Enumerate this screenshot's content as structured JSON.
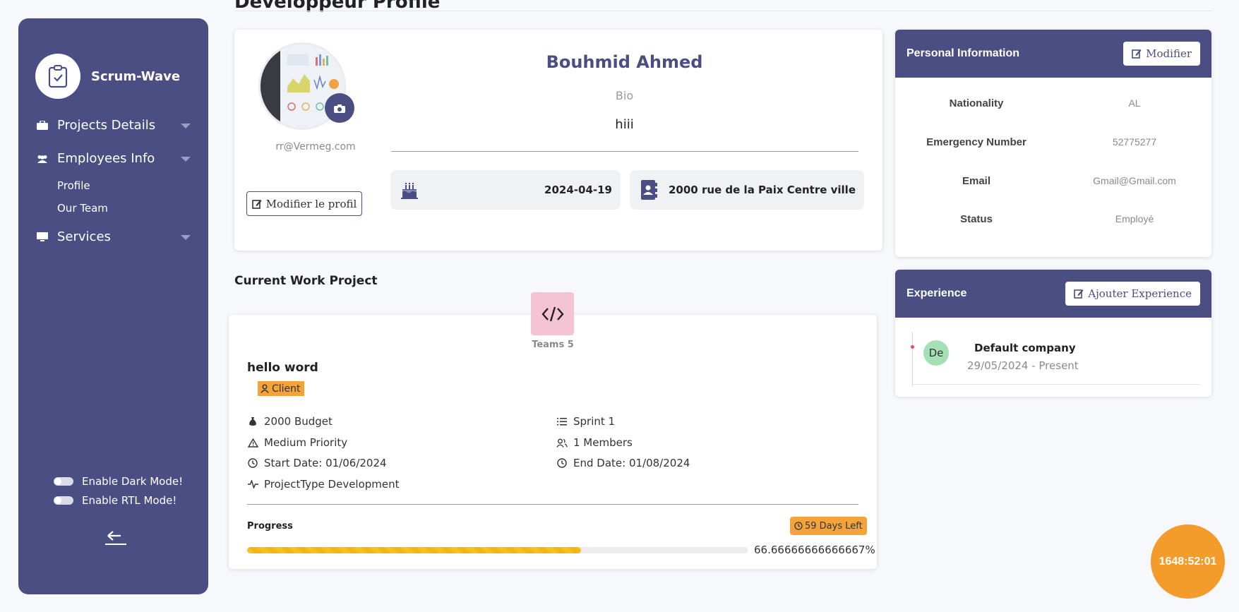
{
  "page": {
    "title": "Développeur Profile"
  },
  "brand": {
    "name": "Scrum-Wave"
  },
  "sidebar": {
    "items": [
      {
        "label": "Projects Details"
      },
      {
        "label": "Employees Info"
      },
      {
        "label": "Services"
      }
    ],
    "subitems": [
      {
        "label": "Profile"
      },
      {
        "label": "Our Team"
      }
    ],
    "toggles": [
      {
        "label": "Enable Dark Mode!"
      },
      {
        "label": "Enable RTL Mode!"
      }
    ]
  },
  "profile": {
    "email": "rr@Vermeg.com",
    "edit_label": "Modifier le profil",
    "name": "Bouhmid Ahmed",
    "bio_label": "Bio",
    "bio": "hiii",
    "birthdate": "2024-04-19",
    "address": "2000 rue de la Paix Centre ville"
  },
  "personal_info": {
    "title": "Personal Information",
    "modify_label": "Modifier",
    "rows": [
      {
        "key": "Nationality",
        "value": "AL"
      },
      {
        "key": "Emergency Number",
        "value": "52775277"
      },
      {
        "key": "Email",
        "value": "Gmail@Gmail.com"
      },
      {
        "key": "Status",
        "value": "Employé"
      }
    ]
  },
  "experience": {
    "title": "Experience",
    "add_label": "Ajouter Experience",
    "items": [
      {
        "initials": "De",
        "company": "Default company",
        "dates": "29/05/2024 - Present"
      }
    ]
  },
  "project": {
    "section_title": "Current Work Project",
    "teams": "Teams 5",
    "name": "hello word",
    "tag": "Client",
    "budget": "2000 Budget",
    "priority": "Medium Priority",
    "start": "Start Date: 01/06/2024",
    "type": "ProjectType Development",
    "sprint": "Sprint 1",
    "members": "1 Members",
    "end": "End Date: 01/08/2024",
    "progress_label": "Progress",
    "days_left": "59 Days Left",
    "progress_value": 0.6666666666666667,
    "progress_text": "66.66666666666667%"
  },
  "timer": {
    "value": "1648:52:01"
  },
  "colors": {
    "primary": "#4a4e82",
    "accent": "#f39c2c",
    "tag": "#f4a23a",
    "progress": "#f5c11e"
  }
}
